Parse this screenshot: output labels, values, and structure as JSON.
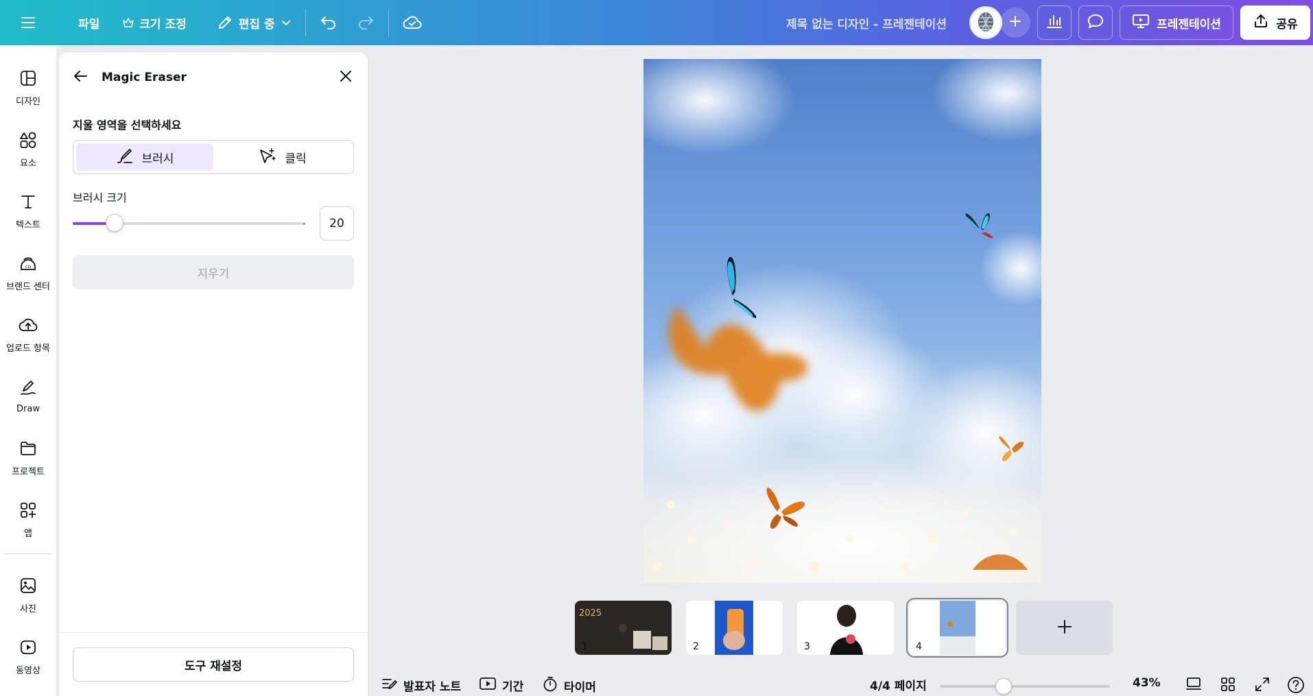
{
  "topbar": {
    "file_label": "파일",
    "resize_label": "크기 조정",
    "edit_mode_label": "편집 중",
    "doc_title": "제목 없는 디자인 - 프레젠테이션",
    "present_label": "프레젠테이션",
    "share_label": "공유"
  },
  "rail": {
    "items": [
      {
        "label": "디자인",
        "icon": "layout-icon"
      },
      {
        "label": "요소",
        "icon": "shapes-icon"
      },
      {
        "label": "텍스트",
        "icon": "text-icon"
      },
      {
        "label": "브랜드 센터",
        "icon": "brand-icon"
      },
      {
        "label": "업로드 항목",
        "icon": "upload-cloud-icon"
      },
      {
        "label": "Draw",
        "icon": "draw-icon"
      },
      {
        "label": "프로젝트",
        "icon": "folder-icon"
      },
      {
        "label": "앱",
        "icon": "apps-icon"
      },
      {
        "label": "사진",
        "icon": "photo-icon"
      },
      {
        "label": "동영상",
        "icon": "video-icon"
      }
    ]
  },
  "panel": {
    "title": "Magic Eraser",
    "select_area_label": "지울 영역을 선택하세요",
    "mode_brush": "브러시",
    "mode_click": "클릭",
    "brush_size_label": "브러시 크기",
    "brush_size_value": "20",
    "brush_size_fraction": 0.18,
    "erase_label": "지우기",
    "reset_label": "도구 재설정"
  },
  "pages": {
    "thumbnails": [
      {
        "number": "1"
      },
      {
        "number": "2"
      },
      {
        "number": "3"
      },
      {
        "number": "4",
        "selected": true
      }
    ]
  },
  "footer": {
    "notes_label": "발표자 노트",
    "duration_label": "기간",
    "timer_label": "타이머",
    "page_indicator": "4/4 페이지",
    "zoom_label": "43%",
    "zoom_fraction": 0.43
  },
  "colors": {
    "accent": "#8b3dff",
    "topbar_start": "#1fbcc9",
    "topbar_end": "#7d4fe2"
  }
}
